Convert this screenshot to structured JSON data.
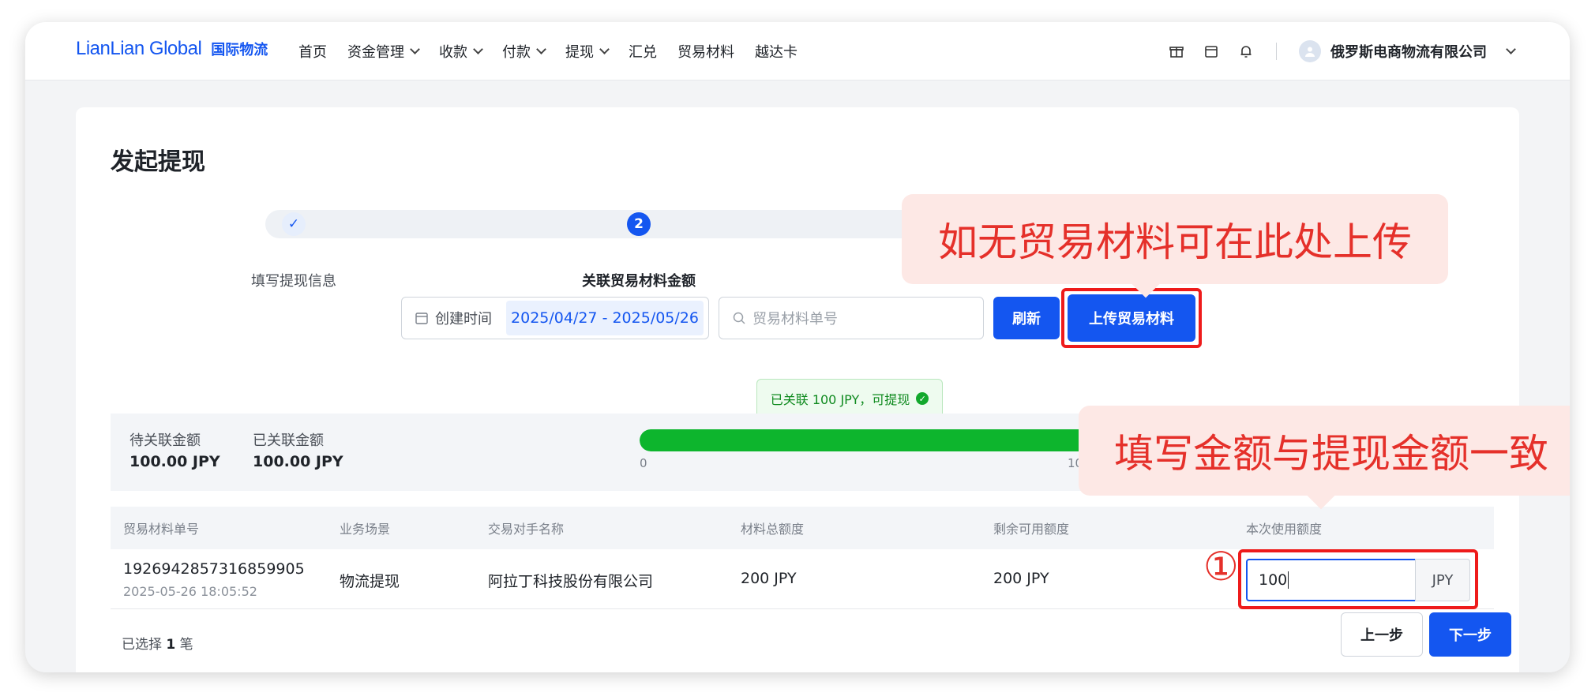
{
  "header": {
    "logo_main": "LianLian Global",
    "logo_sub": "国际物流",
    "nav": [
      {
        "label": "首页",
        "dropdown": false
      },
      {
        "label": "资金管理",
        "dropdown": true
      },
      {
        "label": "收款",
        "dropdown": true
      },
      {
        "label": "付款",
        "dropdown": true
      },
      {
        "label": "提现",
        "dropdown": true
      },
      {
        "label": "汇兑",
        "dropdown": false
      },
      {
        "label": "贸易材料",
        "dropdown": false
      },
      {
        "label": "越达卡",
        "dropdown": false
      }
    ],
    "icons": [
      "gift-icon",
      "calendar-icon",
      "bell-icon"
    ],
    "company": "俄罗斯电商物流有限公司"
  },
  "page": {
    "title": "发起提现",
    "steps": [
      {
        "label": "填写提现信息",
        "status": "done",
        "marker": "✓"
      },
      {
        "label": "关联贸易材料金额",
        "status": "active",
        "marker": "2"
      }
    ]
  },
  "filters": {
    "date_label": "创建时间",
    "date_range": "2025/04/27 - 2025/05/26",
    "search_placeholder": "贸易材料单号",
    "refresh_label": "刷新",
    "upload_label": "上传贸易材料"
  },
  "tooltip": {
    "text": "已关联 100 JPY，可提现"
  },
  "summary": {
    "pending_label": "待关联金额",
    "pending_value": "100.00 JPY",
    "linked_label": "已关联金额",
    "linked_value": "100.00 JPY",
    "progress_fraction": 1.0,
    "tick_start": "0",
    "tick_end": "10"
  },
  "table": {
    "columns": [
      "贸易材料单号",
      "业务场景",
      "交易对手名称",
      "材料总额度",
      "剩余可用额度",
      "本次使用额度"
    ],
    "rows": [
      {
        "id": "1926942857316859905",
        "created": "2025-05-26 18:05:52",
        "scene": "物流提现",
        "counterparty": "阿拉丁科技股份有限公司",
        "total": "200 JPY",
        "remaining": "200 JPY",
        "amount_value": "100",
        "unit": "JPY"
      }
    ]
  },
  "footer": {
    "selected_prefix": "已选择",
    "selected_count": "1",
    "selected_suffix": "笔",
    "prev_label": "上一步",
    "next_label": "下一步"
  },
  "annotations": {
    "callout_upload": "如无贸易材料可在此处上传",
    "callout_amount": "填写金额与提现金额一致",
    "marker": "①",
    "highlight_color": "#ee1b1b"
  },
  "colors": {
    "accent": "#1456f0",
    "success": "#0db52d",
    "callout_bg": "#fde8e5",
    "callout_text": "#e5302a"
  }
}
